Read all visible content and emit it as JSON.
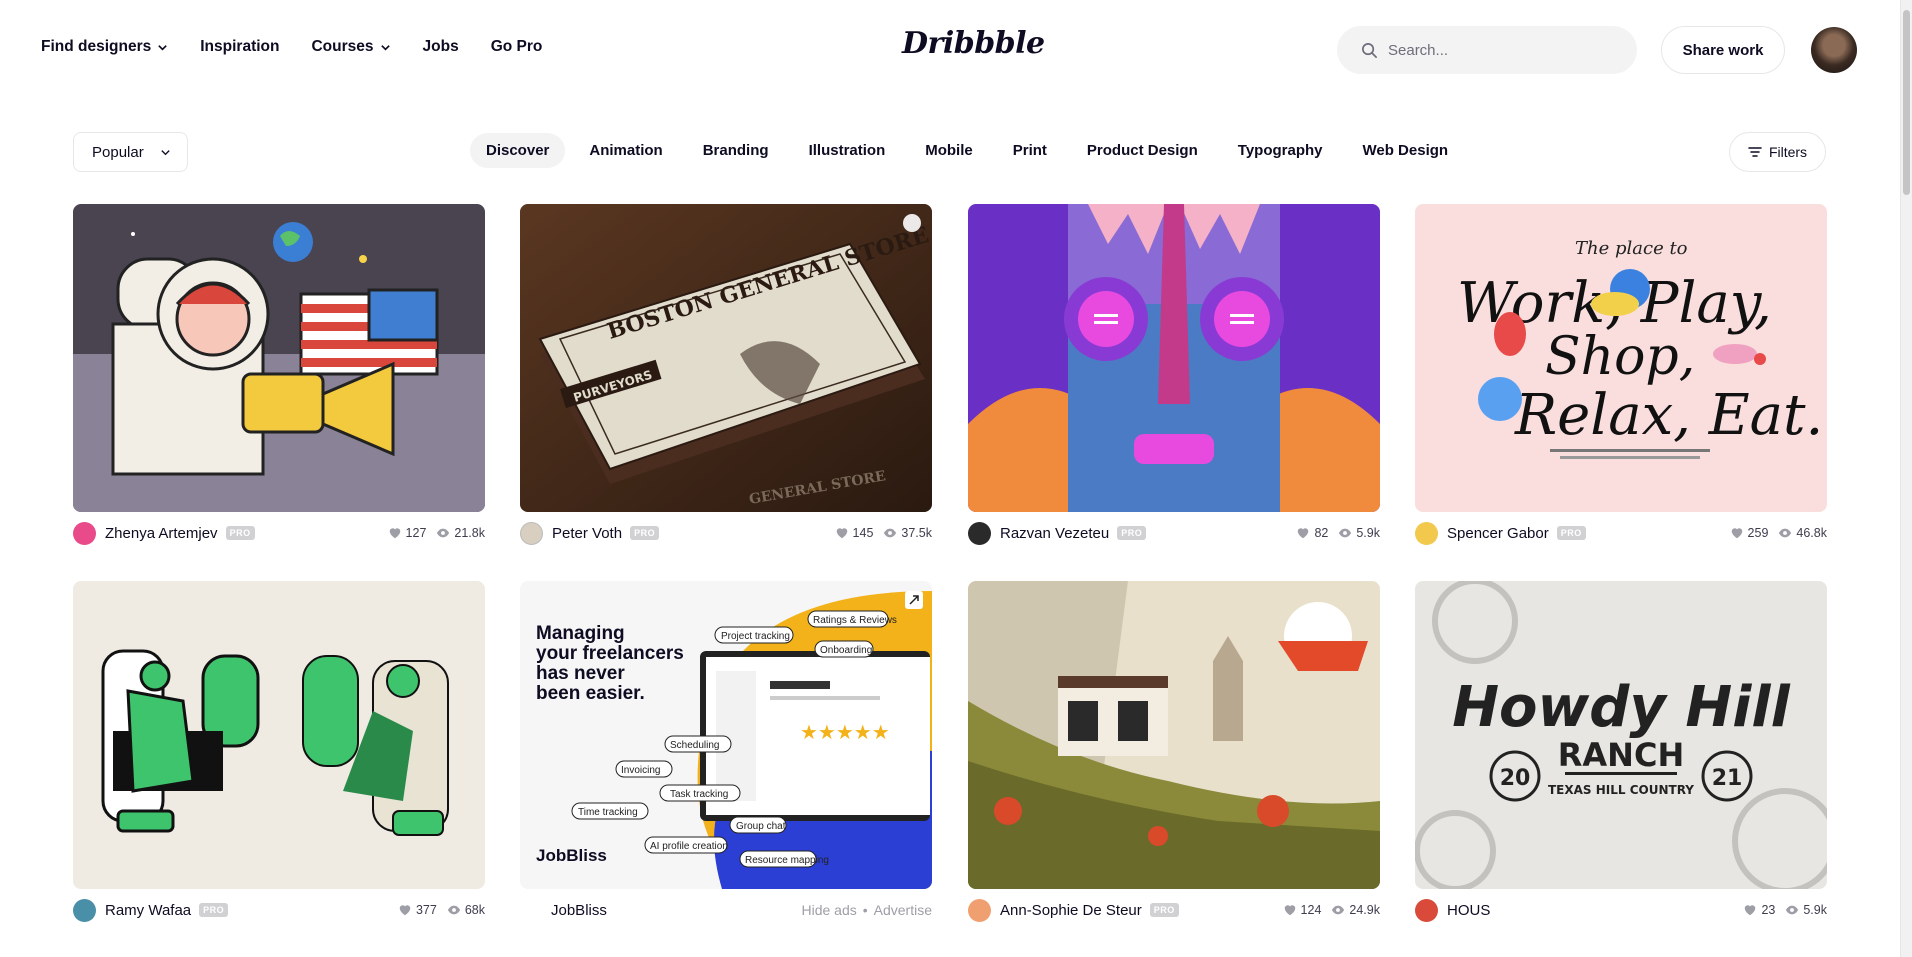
{
  "header": {
    "nav": [
      {
        "label": "Find designers",
        "has_menu": true
      },
      {
        "label": "Inspiration",
        "has_menu": false
      },
      {
        "label": "Courses",
        "has_menu": true
      },
      {
        "label": "Jobs",
        "has_menu": false
      },
      {
        "label": "Go Pro",
        "has_menu": false
      }
    ],
    "logo": "Dribbble",
    "search_placeholder": "Search...",
    "share_label": "Share work"
  },
  "filter_bar": {
    "sort_label": "Popular",
    "categories": [
      "Discover",
      "Animation",
      "Branding",
      "Illustration",
      "Mobile",
      "Print",
      "Product Design",
      "Typography",
      "Web Design"
    ],
    "active_category": "Discover",
    "filters_label": "Filters"
  },
  "shots": [
    {
      "author": "Zhenya Artemjev",
      "pro": "PRO",
      "likes": "127",
      "views": "21.8k",
      "avatar_color": "#e84a8a"
    },
    {
      "author": "Peter Voth",
      "pro": "PRO",
      "likes": "145",
      "views": "37.5k",
      "avatar_color": "#d8cfc0"
    },
    {
      "author": "Razvan Vezeteu",
      "pro": "PRO",
      "likes": "82",
      "views": "5.9k",
      "avatar_color": "#2a2a2a"
    },
    {
      "author": "Spencer Gabor",
      "pro": "PRO",
      "likes": "259",
      "views": "46.8k",
      "avatar_color": "#f2c94c"
    },
    {
      "author": "Ramy Wafaa",
      "pro": "PRO",
      "likes": "377",
      "views": "68k",
      "avatar_color": "#4a8fa8"
    },
    {
      "author": "JobBliss",
      "pro": "",
      "ad_links": [
        "Hide ads",
        "Advertise"
      ],
      "avatar_color": "#ffffff"
    },
    {
      "author": "Ann-Sophie De Steur",
      "pro": "PRO",
      "likes": "124",
      "views": "24.9k",
      "avatar_color": "#f0a070"
    },
    {
      "author": "HOUS",
      "pro": "",
      "likes": "23",
      "views": "5.9k",
      "avatar_color": "#d94a3a"
    }
  ],
  "thumb_text": {
    "store_top": "BOSTON GENERAL STORE",
    "store_badge": "PURVEYORS",
    "store_bottom": "GENERAL STORE",
    "work_line1": "The place to",
    "work_line2": "Work, Play,",
    "work_line3": "Shop,",
    "work_line4": "Relax, Eat.",
    "ad_line1": "Managing",
    "ad_line2": "your freelancers",
    "ad_line3": "has never",
    "ad_line4": "been easier.",
    "ad_brand": "JobBliss",
    "ad_pills": [
      "Project tracking",
      "Ratings & Reviews",
      "Onboarding",
      "Scheduling",
      "Invoicing",
      "Task tracking",
      "Time tracking",
      "Group chat",
      "AI profile creation",
      "Resource mapping"
    ],
    "howdy": "Howdy Hill",
    "ranch": "RANCH",
    "ranch_sub": "TEXAS HILL COUNTRY",
    "num_left": "20",
    "num_right": "21"
  }
}
